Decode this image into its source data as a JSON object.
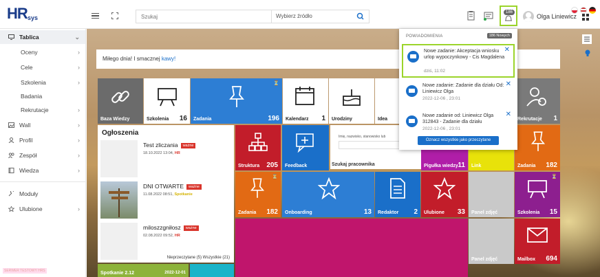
{
  "app": {
    "logo_main": "HR",
    "logo_sub": "sys"
  },
  "header": {
    "search_placeholder": "Szukaj",
    "source_select": "Wybierz źródło",
    "bell_count": "186",
    "user_name": "Olga Liniewicz"
  },
  "sidebar": {
    "items": [
      {
        "label": "Tablica"
      },
      {
        "label": "Oceny"
      },
      {
        "label": "Cele"
      },
      {
        "label": "Szkolenia"
      },
      {
        "label": "Badania"
      },
      {
        "label": "Rekrutacje"
      },
      {
        "label": "Wall"
      },
      {
        "label": "Profil"
      },
      {
        "label": "Zespół"
      },
      {
        "label": "Wiedza"
      },
      {
        "label": "Moduły"
      },
      {
        "label": "Ulubione"
      }
    ],
    "watermark": "SERWER TESTOWY HRS"
  },
  "greeting": {
    "text": "Miłego dnia! I smacznej ",
    "link": "kawy!"
  },
  "tiles": {
    "baza_wiedzy": "Baza Wiedzy",
    "szkolenia": "Szkolenia",
    "szkolenia_n": "16",
    "zadania": "Zadania",
    "zadania_n": "196",
    "kalendarz": "Kalendarz",
    "kalendarz_n": "1",
    "urodziny": "Urodziny",
    "idea": "Idea",
    "rekrutacje": "Rekrutacje",
    "rekrutacje_n": "1",
    "struktura": "Struktura",
    "struktura_n": "205",
    "feedback": "Feedback",
    "szukaj": "Szukaj pracownika",
    "szukaj_hint": "Imię, nazwisko, stanowisko lub",
    "pigulka": "Pigułka wiedzy",
    "pigulka_n": "11",
    "link": "Link",
    "zadania2": "Zadania",
    "zadania2_n": "182",
    "zadania3": "Zadania",
    "zadania3_n": "182",
    "onboarding": "Onboarding",
    "onboarding_n": "13",
    "redaktor": "Redaktor",
    "redaktor_n": "2",
    "ulubione": "Ulubione",
    "ulubione_n": "33",
    "panel1": "Panel zdjęć",
    "szkolenia2": "Szkolenia",
    "szkolenia2_n": "15",
    "panel2": "Panel zdjęć",
    "mailbox": "Mailbox",
    "mailbox_n": "694",
    "spotkanie": "Spotkanie 2.12",
    "spotkanie_date": "2022-12-01"
  },
  "announcements": {
    "title": "Ogłoszenia",
    "items": [
      {
        "name": "Test zliczania",
        "tag": "ważne",
        "date": "18.10.2022 13:04, ",
        "cat": "HR"
      },
      {
        "name": "DNI OTWARTE",
        "tag": "ważne",
        "date": "11.08.2022 08:51, ",
        "cat": "Spotkanie"
      },
      {
        "name": "miloszzgniłosz",
        "tag": "ważne",
        "date": "02.08.2022 09:52, ",
        "cat": "HR"
      }
    ],
    "footer": "Nieprzeczytane (5)   Wszystkie (21)"
  },
  "notifications": {
    "header": "POWIADOMIENIA",
    "count": "186 Nowych",
    "items": [
      {
        "text": "Nowe zadanie: Akceptacja wniosku urlop wypoczynkowy - Cis Magdalena",
        "date": "dziś, 11:02"
      },
      {
        "text": "Nowe zadanie: Zadanie dla działu Od: Liniewicz Olga",
        "date": "2022-12-06 , 23:01"
      },
      {
        "text": "Nowe zadanie od: Liniewicz Olga 312843 - Zadanie dla działu",
        "date": "2022-12-06 , 23:01"
      }
    ],
    "mark_all": "Oznacz wszystkie jako przeczytane"
  },
  "colors": {
    "accent": "#1a6fc9",
    "highlight": "#9bd42a",
    "red": "#d9342b",
    "green": "#8db33a"
  }
}
